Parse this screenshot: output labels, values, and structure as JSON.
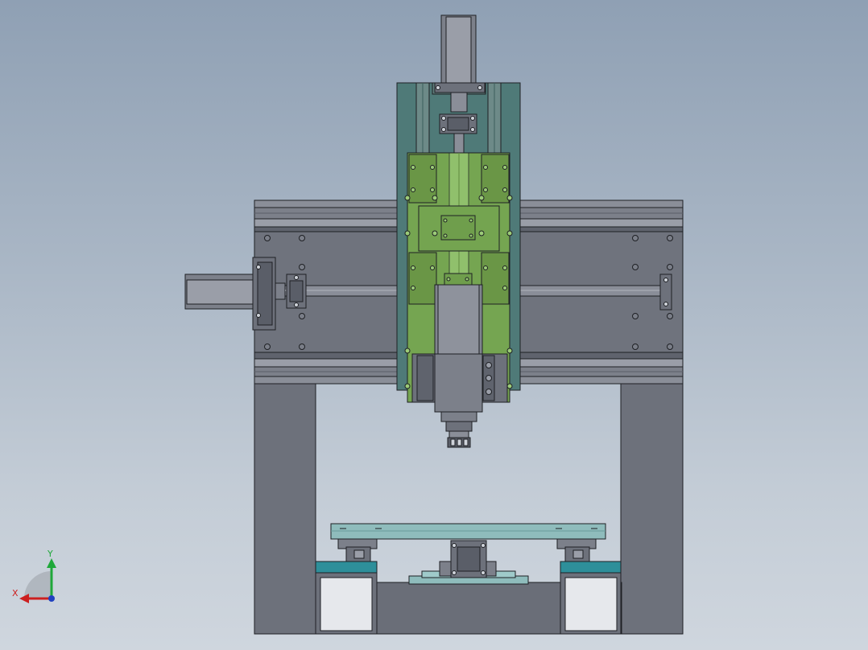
{
  "colors": {
    "background_top": "#8fa0b4",
    "background_bottom": "#cfd6de",
    "frame": "#6d717b",
    "frame_dark": "#5a5e68",
    "rail": "#7c808a",
    "rail_light": "#9a9ea8",
    "plate_teal": "#4f7a78",
    "carriage_green": "#6f9e4c",
    "carriage_green_light": "#8ab862",
    "table_top": "#8fbcbc",
    "cyan_block": "#2e8f9a",
    "outline": "#1e2024",
    "axis_x": "#cc1f1f",
    "axis_y": "#1fa83a",
    "axis_z": "#2040c0"
  },
  "triad": {
    "x_label": "X",
    "y_label": "Y",
    "icon": "coordinate-triad-icon"
  }
}
